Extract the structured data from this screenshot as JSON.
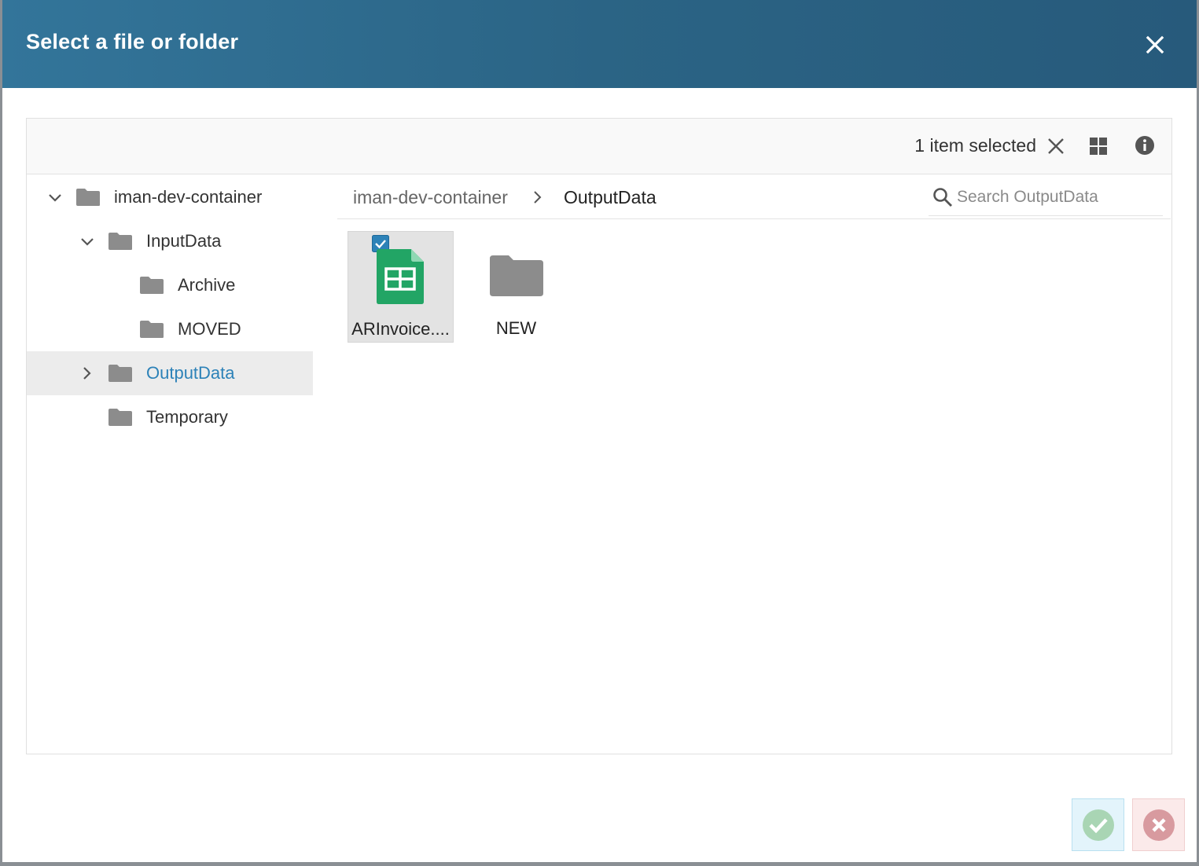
{
  "dialog": {
    "title": "Select a file or folder"
  },
  "toolbar": {
    "selection_text": "1 item selected"
  },
  "tree": {
    "items": [
      {
        "label": "iman-dev-container"
      },
      {
        "label": "InputData"
      },
      {
        "label": "Archive"
      },
      {
        "label": "MOVED"
      },
      {
        "label": "OutputData"
      },
      {
        "label": "Temporary"
      }
    ]
  },
  "breadcrumb": {
    "root": "iman-dev-container",
    "current": "OutputData"
  },
  "search": {
    "placeholder": "Search OutputData",
    "value": ""
  },
  "files": [
    {
      "label": "ARInvoice....",
      "type": "spreadsheet",
      "selected": true
    },
    {
      "label": "NEW",
      "type": "folder",
      "selected": false
    }
  ],
  "colors": {
    "header": "#2b6485",
    "accent": "#2d82b8",
    "spreadsheet": "#22a565",
    "folder": "#8c8c8c"
  }
}
